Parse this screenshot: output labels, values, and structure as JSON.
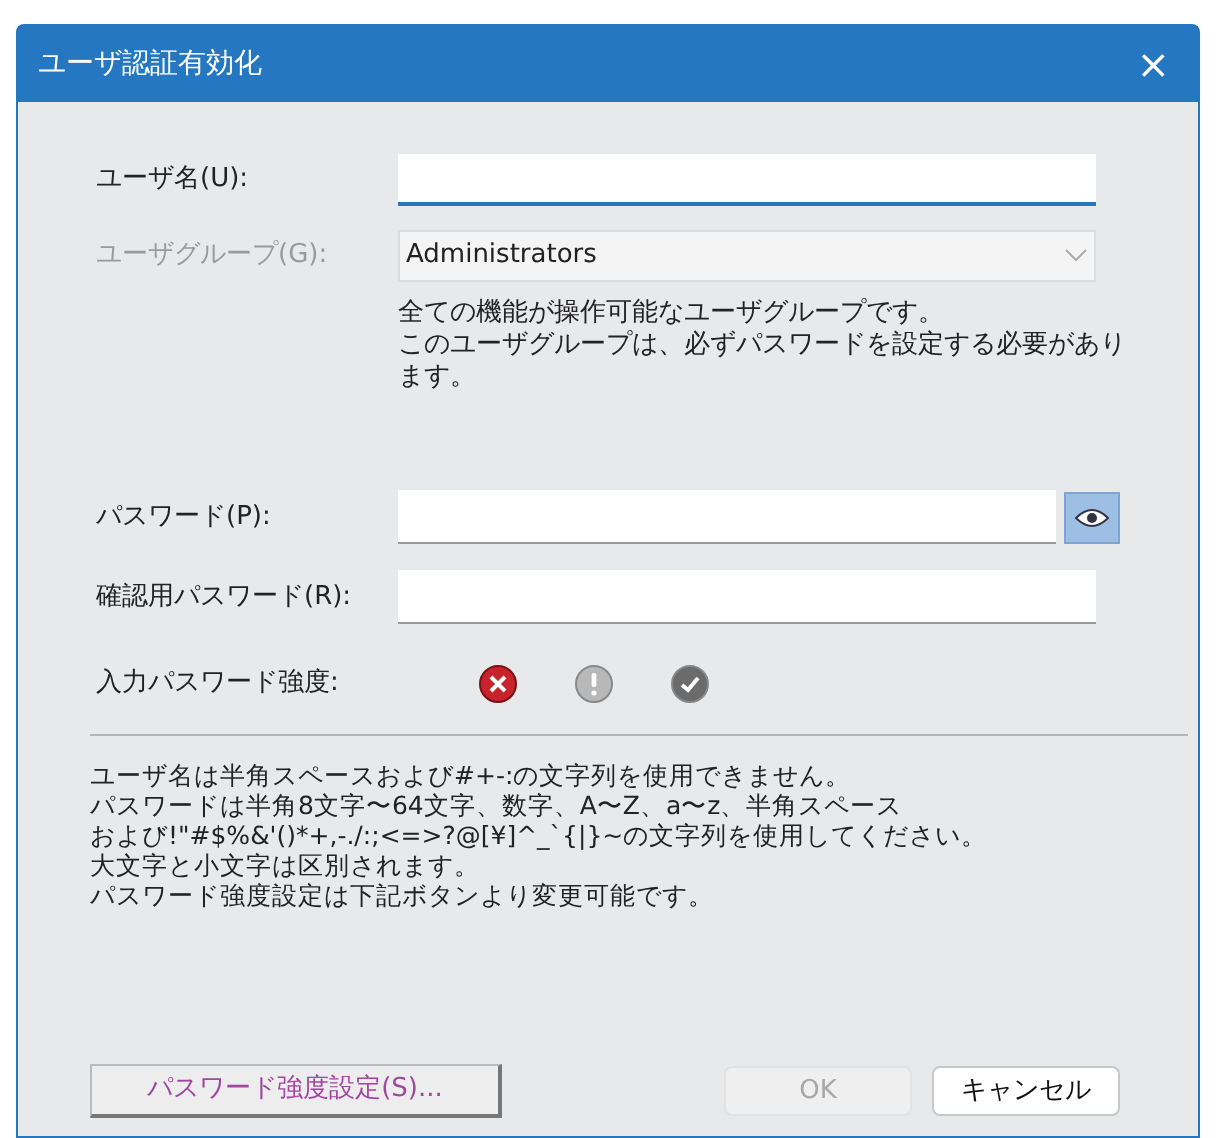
{
  "window": {
    "title": "ユーザ認証有効化",
    "close": "×"
  },
  "username": {
    "label": "ユーザ名(U):",
    "focused": true
  },
  "group": {
    "label": "ユーザグループ(G):",
    "value": "Administrators",
    "disabled": true,
    "description": [
      "全ての機能が操作可能なユーザグループです。",
      "このユーザグループは、必ずパスワードを設定する必要があり",
      "ます。"
    ]
  },
  "password": {
    "label": "パスワード(P):"
  },
  "confirm": {
    "label": "確認用パスワード(R):"
  },
  "strength": {
    "label": "入力パスワード強度:",
    "icons": [
      {
        "kind": "error",
        "active": true
      },
      {
        "kind": "warning",
        "active": false
      },
      {
        "kind": "ok",
        "active": false
      }
    ]
  },
  "notes": [
    "ユーザ名は半角スペースおよび#+-:の文字列を使用できません。",
    "パスワードは半角8文字〜64文字、数字、A〜Z、a〜z、半角スペース",
    "および!\"#$%&'()*+,-./:;<=>?@[¥]^_`{|}~の文字列を使用してください。",
    "大文字と小文字は区別されます。",
    "パスワード強度設定は下記ボタンより変更可能です。"
  ],
  "buttons": [
    {
      "label": "パスワード強度設定(S)...",
      "kind": "settings",
      "disabled": false
    },
    {
      "label": "OK",
      "kind": "ok",
      "disabled": true
    },
    {
      "label": "キャンセル",
      "kind": "cancel",
      "disabled": false
    }
  ]
}
